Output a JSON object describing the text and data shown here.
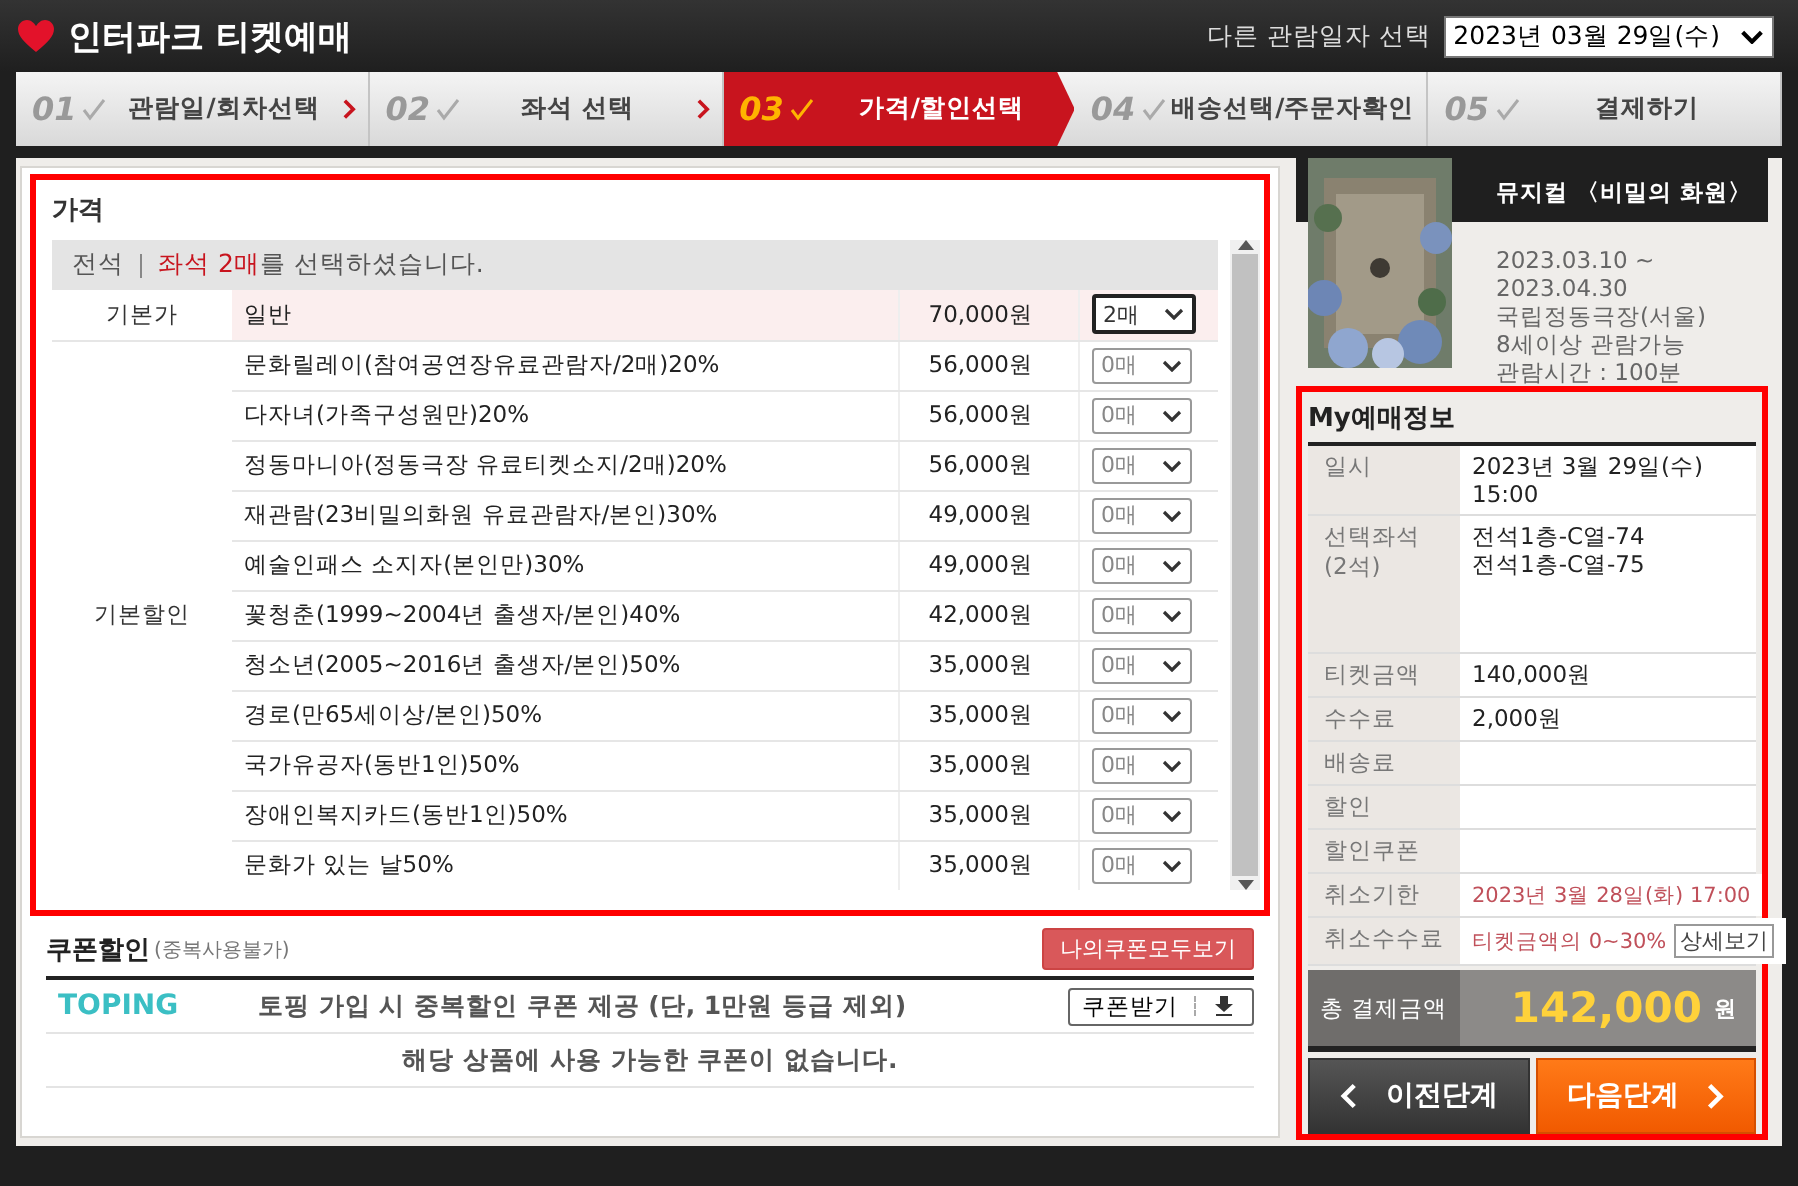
{
  "header": {
    "logo_text": "인터파크 티켓예매",
    "date_label": "다른 관람일자 선택",
    "date_value": "2023년 03월 29일(수)"
  },
  "steps": [
    {
      "number": "01",
      "label": "관람일/회차선택",
      "selected": false
    },
    {
      "number": "02",
      "label": "좌석 선택",
      "selected": false
    },
    {
      "number": "03",
      "label": "가격/할인선택",
      "selected": true
    },
    {
      "number": "04",
      "label": "배송선택/주문자확인",
      "selected": false
    },
    {
      "number": "05",
      "label": "결제하기",
      "selected": false
    }
  ],
  "price": {
    "title": "가격",
    "seat_grade": "전석",
    "notice": [
      {
        "text": "좌석 2매",
        "highlight": true
      },
      {
        "text": "를 선택하셨습니다.",
        "highlight": false
      }
    ],
    "groups": [
      {
        "name": "기본가",
        "rows": [
          {
            "label": "일반",
            "price": "70,000원",
            "count": "2매",
            "selected": true
          }
        ]
      },
      {
        "name": "기본할인",
        "rows": [
          {
            "label": "문화릴레이(참여공연장유료관람자/2매)20%",
            "price": "56,000원",
            "count": "0매",
            "selected": false
          },
          {
            "label": "다자녀(가족구성원만)20%",
            "price": "56,000원",
            "count": "0매",
            "selected": false
          },
          {
            "label": "정동마니아(정동극장 유료티켓소지/2매)20%",
            "price": "56,000원",
            "count": "0매",
            "selected": false
          },
          {
            "label": "재관람(23비밀의화원 유료관람자/본인)30%",
            "price": "49,000원",
            "count": "0매",
            "selected": false
          },
          {
            "label": "예술인패스 소지자(본인만)30%",
            "price": "49,000원",
            "count": "0매",
            "selected": false
          },
          {
            "label": "꽃청춘(1999~2004년 출생자/본인)40%",
            "price": "42,000원",
            "count": "0매",
            "selected": false
          },
          {
            "label": "청소년(2005~2016년 출생자/본인)50%",
            "price": "35,000원",
            "count": "0매",
            "selected": false
          },
          {
            "label": "경로(만65세이상/본인)50%",
            "price": "35,000원",
            "count": "0매",
            "selected": false
          },
          {
            "label": "국가유공자(동반1인)50%",
            "price": "35,000원",
            "count": "0매",
            "selected": false
          },
          {
            "label": "장애인복지카드(동반1인)50%",
            "price": "35,000원",
            "count": "0매",
            "selected": false
          },
          {
            "label": "문화가 있는 날50%",
            "price": "35,000원",
            "count": "0매",
            "selected": false
          }
        ]
      }
    ]
  },
  "coupon": {
    "title": "쿠폰할인",
    "note": "(중복사용불가)",
    "view_all": "나의쿠폰모두보기",
    "brand": "TOPING",
    "offer": "토핑 가입 시 중복할인 쿠폰 제공 (단, 1만원 등급 제외)",
    "get_button": "쿠폰받기",
    "empty_message": "해당 상품에 사용 가능한 쿠폰이 없습니다."
  },
  "show": {
    "title": "뮤지컬 〈비밀의 화원〉",
    "info": [
      "2023.03.10 ~",
      "2023.04.30",
      "국립정동극장(서울)",
      "8세이상 관람가능",
      "관람시간 : 100분"
    ]
  },
  "my_booking": {
    "title": "My예매정보",
    "rows": [
      {
        "kind": "text",
        "label": "일시",
        "values": [
          "2023년 3월 29일(수) 15:00"
        ]
      },
      {
        "kind": "text",
        "label": "선택좌석",
        "sublabel": "(2석)",
        "values": [
          "전석1층-C열-74",
          "전석1층-C열-75"
        ]
      },
      {
        "kind": "text",
        "label": "티켓금액",
        "values": [
          "140,000원"
        ]
      },
      {
        "kind": "text",
        "label": "수수료",
        "values": [
          "2,000원"
        ]
      },
      {
        "kind": "text",
        "label": "배송료"
      },
      {
        "kind": "text",
        "label": "할인"
      },
      {
        "kind": "text",
        "label": "할인쿠폰"
      },
      {
        "kind": "notice",
        "label": "취소기한",
        "values": [
          "2023년 3월 28일(화) 17:00"
        ]
      },
      {
        "kind": "notice_button",
        "label": "취소수수료",
        "values": [
          "티켓금액의 0~30%"
        ],
        "button": "상세보기"
      }
    ],
    "total": {
      "label": "총 결제금액",
      "amount": "142,000",
      "unit": "원"
    },
    "prev_button": "이전단계",
    "next_button": "다음단계"
  }
}
